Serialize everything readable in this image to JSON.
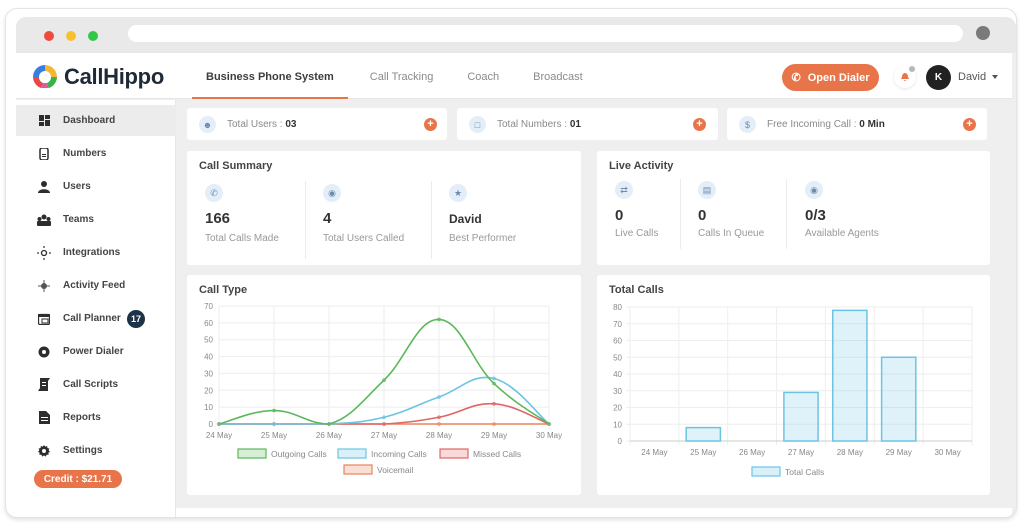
{
  "window": {
    "traffic_lights": [
      "#ed4b3f",
      "#f5c031",
      "#33c748"
    ]
  },
  "brand": {
    "name": "CallHippo",
    "accent": "#e8744a"
  },
  "topbar": {
    "tabs": [
      {
        "label": "Business Phone System",
        "active": true
      },
      {
        "label": "Call Tracking",
        "active": false
      },
      {
        "label": "Coach",
        "active": false
      },
      {
        "label": "Broadcast",
        "active": false
      }
    ],
    "open_dialer_label": "Open Dialer",
    "avatar_initial": "K",
    "user_name": "David"
  },
  "sidebar": {
    "items": [
      {
        "label": "Dashboard",
        "icon": "dashboard-icon",
        "active": true
      },
      {
        "label": "Numbers",
        "icon": "numbers-icon"
      },
      {
        "label": "Users",
        "icon": "user-icon"
      },
      {
        "label": "Teams",
        "icon": "teams-icon"
      },
      {
        "label": "Integrations",
        "icon": "integrations-icon"
      },
      {
        "label": "Activity Feed",
        "icon": "activity-feed-icon"
      },
      {
        "label": "Call Planner",
        "icon": "calendar-icon",
        "badge": "17"
      },
      {
        "label": "Power Dialer",
        "icon": "power-dialer-icon"
      },
      {
        "label": "Call Scripts",
        "icon": "script-icon"
      },
      {
        "label": "Reports",
        "icon": "report-icon"
      },
      {
        "label": "Settings",
        "icon": "gear-icon"
      }
    ],
    "credit_label": "Credit : $21.71"
  },
  "stats": [
    {
      "label": "Total Users : ",
      "value": "03",
      "icon": "users-icon"
    },
    {
      "label": "Total Numbers : ",
      "value": "01",
      "icon": "numbers-icon"
    },
    {
      "label": "Free Incoming Call : ",
      "value": "0 Min",
      "icon": "dollar-icon"
    }
  ],
  "call_summary": {
    "title": "Call Summary",
    "metrics": [
      {
        "value": "166",
        "label": "Total Calls Made",
        "icon": "phone-icon"
      },
      {
        "value": "4",
        "label": "Total Users Called",
        "icon": "user-circle-icon"
      },
      {
        "value": "David",
        "label": "Best Performer",
        "icon": "star-icon"
      }
    ]
  },
  "live_activity": {
    "title": "Live Activity",
    "metrics": [
      {
        "value": "0",
        "label": "Live Calls",
        "icon": "live-call-icon"
      },
      {
        "value": "0",
        "label": "Calls In Queue",
        "icon": "queue-icon"
      },
      {
        "value": "0/3",
        "label": "Available Agents",
        "icon": "agent-icon"
      }
    ]
  },
  "chart_data": [
    {
      "type": "line",
      "title": "Call Type",
      "categories": [
        "24 May",
        "25 May",
        "26 May",
        "27 May",
        "28 May",
        "29 May",
        "30 May"
      ],
      "ylim": [
        0,
        70
      ],
      "yticks": [
        0,
        10,
        20,
        30,
        40,
        50,
        60,
        70
      ],
      "grid": true,
      "legend": "bottom",
      "series": [
        {
          "name": "Outgoing Calls",
          "color": "#5cb85c",
          "values": [
            0,
            8,
            0,
            26,
            62,
            24,
            0
          ]
        },
        {
          "name": "Incoming Calls",
          "color": "#6cc4e4",
          "values": [
            0,
            0,
            0,
            4,
            16,
            27,
            0
          ]
        },
        {
          "name": "Missed Calls",
          "color": "#e06666",
          "values": [
            0,
            0,
            0,
            0,
            4,
            12,
            0
          ]
        },
        {
          "name": "Voicemail",
          "color": "#e8845a",
          "values": [
            0,
            0,
            0,
            0,
            0,
            0,
            0
          ]
        }
      ]
    },
    {
      "type": "bar",
      "title": "Total Calls",
      "categories": [
        "24 May",
        "25 May",
        "26 May",
        "27 May",
        "28 May",
        "29 May",
        "30 May"
      ],
      "ylim": [
        0,
        80
      ],
      "yticks": [
        0,
        10,
        20,
        30,
        40,
        50,
        60,
        70,
        80
      ],
      "grid": true,
      "legend": "bottom",
      "series": [
        {
          "name": "Total Calls",
          "color": "#6cc4e4",
          "values": [
            0,
            8,
            0,
            29,
            78,
            50,
            0
          ]
        }
      ]
    }
  ]
}
